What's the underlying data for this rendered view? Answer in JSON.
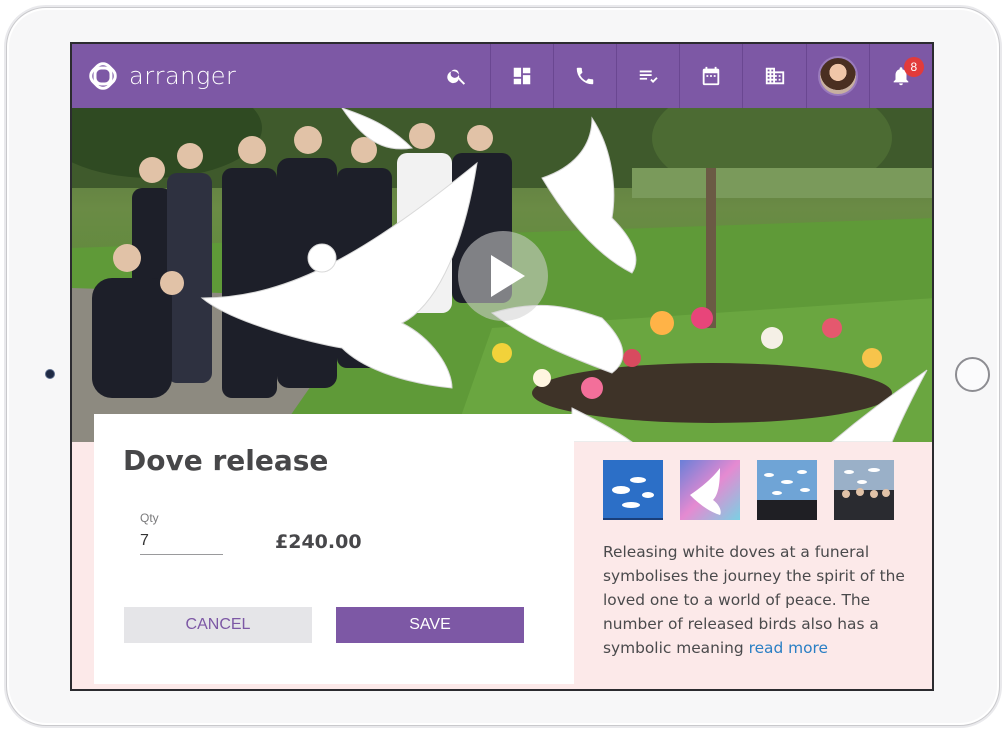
{
  "app": {
    "name": "arranger"
  },
  "nav": {
    "items": [
      {
        "icon": "search-icon"
      },
      {
        "icon": "dashboard-icon"
      },
      {
        "icon": "phone-icon"
      },
      {
        "icon": "checklist-icon"
      },
      {
        "icon": "calendar-icon"
      },
      {
        "icon": "building-icon"
      },
      {
        "icon": "avatar"
      },
      {
        "icon": "bell-icon"
      }
    ],
    "notification_count": "8"
  },
  "hero": {
    "play_icon": "play-icon"
  },
  "card": {
    "title": "Dove release",
    "qty_label": "Qty",
    "qty_value": "7",
    "price": "£240.00",
    "cancel_label": "CANCEL",
    "save_label": "SAVE"
  },
  "details": {
    "description": "Releasing white doves at a funeral symbolises the journey the spirit of the loved one to a world of peace. The number of released birds also has a symbolic meaning",
    "read_more": "read more"
  },
  "colors": {
    "brand": "#7d58a5",
    "panel_background": "#fce9e9",
    "badge": "#e23b3b",
    "link": "#2a7fc4"
  }
}
